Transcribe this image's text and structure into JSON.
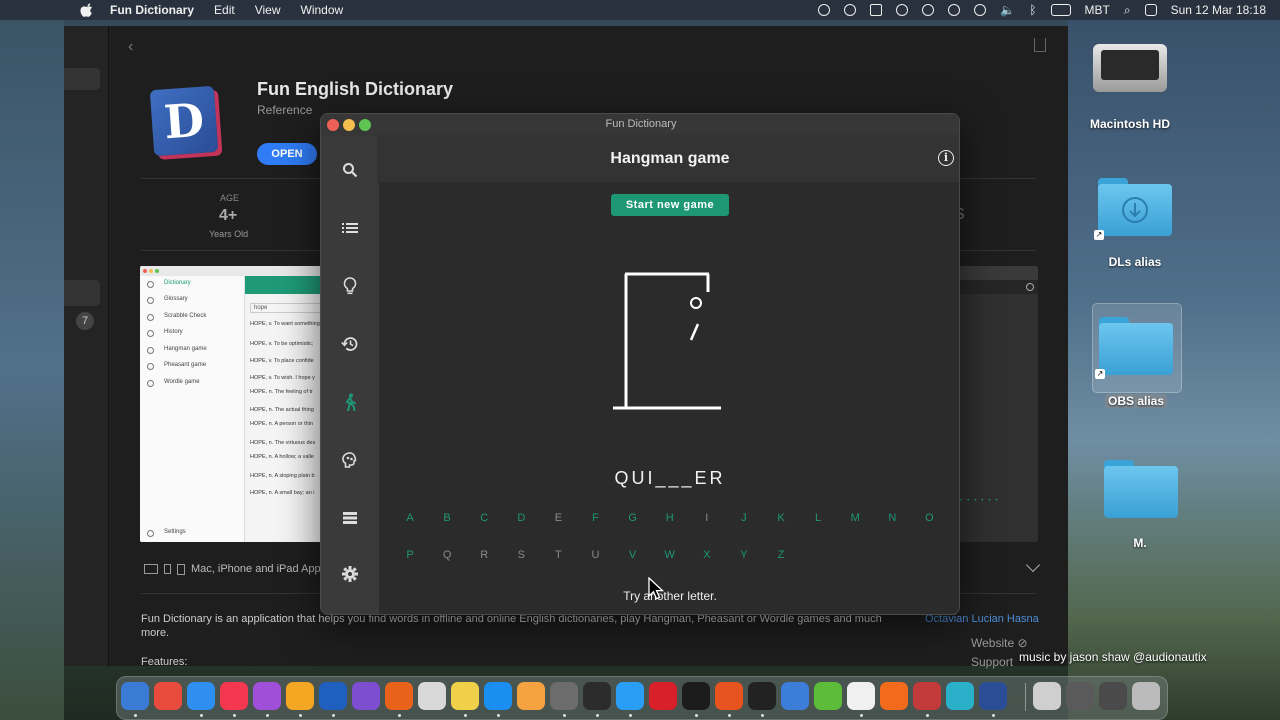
{
  "menubar": {
    "app_name": "Fun Dictionary",
    "items": [
      "Edit",
      "View",
      "Window"
    ],
    "input_source": "MBT",
    "datetime": "Sun 12 Mar  18:18"
  },
  "store": {
    "app_title": "Fun English Dictionary",
    "category": "Reference",
    "open_label": "OPEN",
    "age_label": "AGE",
    "age_value": "4+",
    "age_sub": "Years Old",
    "sidebar_badge": "7",
    "devices": "Mac, iPhone and iPad App",
    "description": "Fun Dictionary is an application that helps you find words in offline and online English dictionaries, play Hangman, Pheasant or Wordle games and much more.",
    "features_label": "Features:",
    "developer": "Octavian Lucian Hasna",
    "website": "Website",
    "support": "Support",
    "screenshot": {
      "sidebar_items": [
        "Dictionary",
        "Glossary",
        "Scrabble Check",
        "History",
        "Hangman game",
        "Pheasant game",
        "Wordle game"
      ],
      "settings": "Settings",
      "search_value": "hope",
      "lines": [
        "HOPE, v. To want something",
        "HOPE, v. To be optimistic;",
        "HOPE, v. To place confide",
        "HOPE, v. To wish. I hope y",
        "HOPE, n. The feeling of tr",
        "HOPE, n. The actual thing",
        "HOPE, n. A person or thin",
        "HOPE, n. The virtuous des",
        "HOPE, n. A hollow; a valle",
        "HOPE, n. A sloping plain b",
        "HOPE, n. A small bay; an i"
      ]
    }
  },
  "fd": {
    "window_title": "Fun Dictionary",
    "header_title": "Hangman game",
    "info_glyph": "i",
    "start_label": "Start new game",
    "word": "QUI___ER",
    "letters_row1": [
      "A",
      "B",
      "C",
      "D",
      "E",
      "F",
      "G",
      "H",
      "I",
      "J",
      "K",
      "L",
      "M",
      "N",
      "O"
    ],
    "letters_row2": [
      "P",
      "Q",
      "R",
      "S",
      "T",
      "U",
      "V",
      "W",
      "X",
      "Y",
      "Z"
    ],
    "used_letters": [
      "E",
      "I",
      "Q",
      "R",
      "S",
      "T",
      "U"
    ],
    "status": "Try another letter.",
    "colors": {
      "accent": "#1e9775",
      "used": "#8a8a8a"
    }
  },
  "desktop": {
    "icons": [
      "Macintosh HD",
      "DLs alias",
      "OBS alias",
      "M."
    ]
  },
  "watermark": "music by jason shaw @audionautix"
}
